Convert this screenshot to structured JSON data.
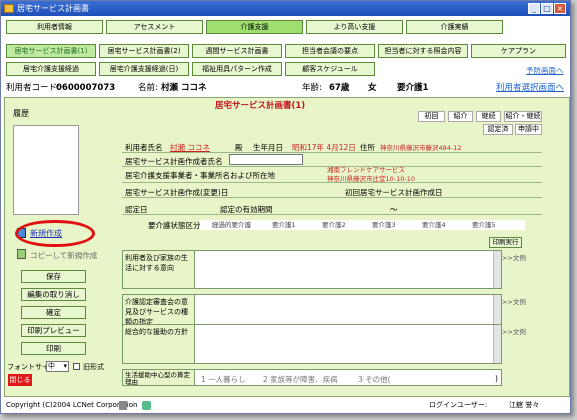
{
  "window": {
    "title": "居宅サービス計画書",
    "buttons": [
      "_",
      "□",
      "×"
    ]
  },
  "tabs_row1": [
    "利用者情報",
    "アセスメント",
    "介護支援",
    "より高い支援",
    "介護実績"
  ],
  "tabs_row2": [
    "居宅サービス計画書(1)",
    "居宅サービス計画書(2)",
    "週間サービス計画書",
    "担当者会議の要点",
    "担当者に対する照会内容",
    "ケアプラン"
  ],
  "tabs_row3": [
    "居宅介護支援経過",
    "居宅介護支援経過(日)",
    "福祉用具パターン作成",
    "顧客スケジュール"
  ],
  "links": {
    "yotei": "予防画面へ",
    "riyosha_select": "利用者選択画面へ"
  },
  "info": {
    "code_label": "利用者コード:",
    "code": "0600007073",
    "name_label": "名前:",
    "name": "村瀬 ココネ",
    "age_label": "年齢:",
    "age": "67歳",
    "sex": "女",
    "care_level": "要介護1"
  },
  "main": {
    "title": "居宅サービス計画書(1)",
    "history_label": "履歴",
    "new_link": "新規作成",
    "copy_link": "コピーして新規作成",
    "buttons": [
      "保存",
      "編集の取り消し",
      "確定",
      "印刷プレビュー",
      "印刷"
    ],
    "font_label": "フォントサイズ",
    "font_value": "中",
    "old_format": "旧形式",
    "close": "閉じる",
    "status_boxes": [
      "初回",
      "紹介",
      "継続",
      "紹介・継続"
    ],
    "cert_boxes": [
      "認定済",
      "申請中"
    ],
    "riyosha_label": "利用者氏名",
    "riyosha_name": "村瀬 ココネ",
    "dono": "殿",
    "birth_label": "生年月日",
    "birth": "昭和17年 4月12日",
    "address_label": "住所",
    "address": "神奈川県藤沢市藤沢484-12",
    "sakuseisha_label": "居宅サービス計画作成者氏名",
    "jigyosha_label": "居宅介護支援事業者・事業所名および所在地",
    "jigyosha_name": "湘南フレンドケアサービス",
    "jigyosha_addr": "神奈川県藤沢市辻堂10-10-10",
    "henko_label": "居宅サービス計画作成(変更)日",
    "shokai_label": "初回居宅サービス計画作成日",
    "nintei_label": "認定日",
    "yuko_label": "認定の有効期間",
    "tilde": "〜",
    "kubun_label": "要介護状態区分",
    "levels": [
      "経過的要介護",
      "要介護1",
      "要介護2",
      "要介護3",
      "要介護4",
      "要介護5"
    ],
    "print_btn": "印刷実行",
    "sections": [
      {
        "label": "利用者及び家族の生活に対する意向",
        "bunrei": ">>文例"
      },
      {
        "label": "介護認定審査会の意見及びサービスの種類の指定",
        "bunrei": ">>文例"
      },
      {
        "label": "総合的な援助の方針",
        "bunrei": ">>文例"
      }
    ],
    "santei_label": "生活援助中心型の算定理由",
    "santei_options": [
      "1 一人暮らし",
      "2 家族等が障害、疾病",
      "3 その他("
    ],
    "paren_close": ")"
  },
  "footer": {
    "copyright": "Copyright (C)2004 LCNet Corporation",
    "login_label": "ログインユーザー:",
    "login_user": "江舘 誉々"
  }
}
